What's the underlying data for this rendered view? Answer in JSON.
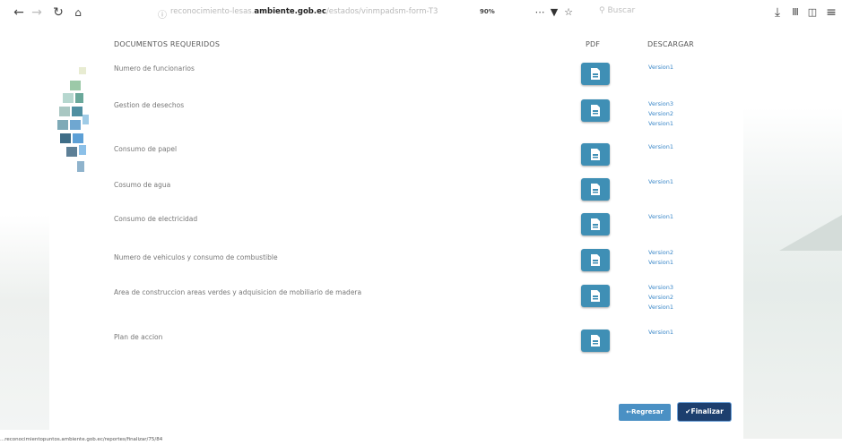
{
  "browser": {
    "url_prefix": "reconocimiento-lesas.",
    "url_domain": "ambiente.gob.ec",
    "url_path": "/estados/vinmpadsm-form-T3",
    "zoom": "90%",
    "search_placeholder": "Buscar",
    "nav_icons": [
      "back-icon",
      "forward-icon",
      "reload-icon",
      "home-icon"
    ],
    "right_icons": [
      "download-icon",
      "library-icon",
      "sidebar-icon",
      "menu-icon"
    ]
  },
  "table": {
    "col_documents": "DOCUMENTOS REQUERIDOS",
    "col_pdf": "PDF",
    "col_download": "DESCARGAR",
    "rows": [
      {
        "label": "Numero de funcionarios",
        "versions": [
          "Version1"
        ]
      },
      {
        "label": "Gestion de desechos",
        "versions": [
          "Version3",
          "Version2",
          "Version1"
        ]
      },
      {
        "label": "Consumo de papel",
        "versions": [
          "Version1"
        ]
      },
      {
        "label": "Cosumo de agua",
        "versions": [
          "Version1"
        ]
      },
      {
        "label": "Consumo de electricidad",
        "versions": [
          "Version1"
        ]
      },
      {
        "label": "Numero de vehiculos y consumo de combustible",
        "versions": [
          "Version2",
          "Version1"
        ]
      },
      {
        "label": "Area de construccion areas verdes y adquisicion de mobiliario de madera",
        "versions": [
          "Version3",
          "Version2",
          "Version1"
        ]
      },
      {
        "label": "Plan de accion",
        "versions": [
          "Version1"
        ]
      }
    ]
  },
  "actions": {
    "back_label": "Regresar",
    "finish_label": "Finalizar"
  },
  "status_bar": "...reconocimientopuntos.ambiente.gob.ec/reportes/finalizar/75/84",
  "colors": {
    "pdf_button": "#3f8fb5",
    "link": "#3a87c8",
    "back_button": "#4a90c4",
    "finish_button": "#1d3f6e"
  }
}
